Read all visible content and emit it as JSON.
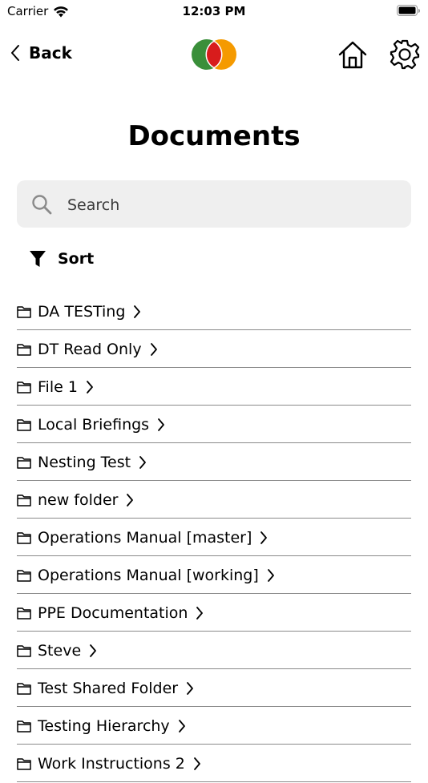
{
  "status_bar": {
    "carrier": "Carrier",
    "time": "12:03 PM"
  },
  "nav": {
    "back_label": "Back"
  },
  "page": {
    "title": "Documents"
  },
  "search": {
    "placeholder": "Search"
  },
  "sort": {
    "label": "Sort"
  },
  "folders": [
    "DA TESTing",
    "DT Read Only",
    "File 1",
    "Local Briefings",
    "Nesting Test",
    "new folder",
    "Operations Manual [master]",
    "Operations Manual [working]",
    "PPE Documentation",
    "Steve",
    "Test Shared Folder",
    "Testing Hierarchy",
    "Work Instructions 2"
  ],
  "colors": {
    "logo_green": "#3a8f3a",
    "logo_red": "#d81c1c",
    "logo_orange": "#f59a00"
  }
}
